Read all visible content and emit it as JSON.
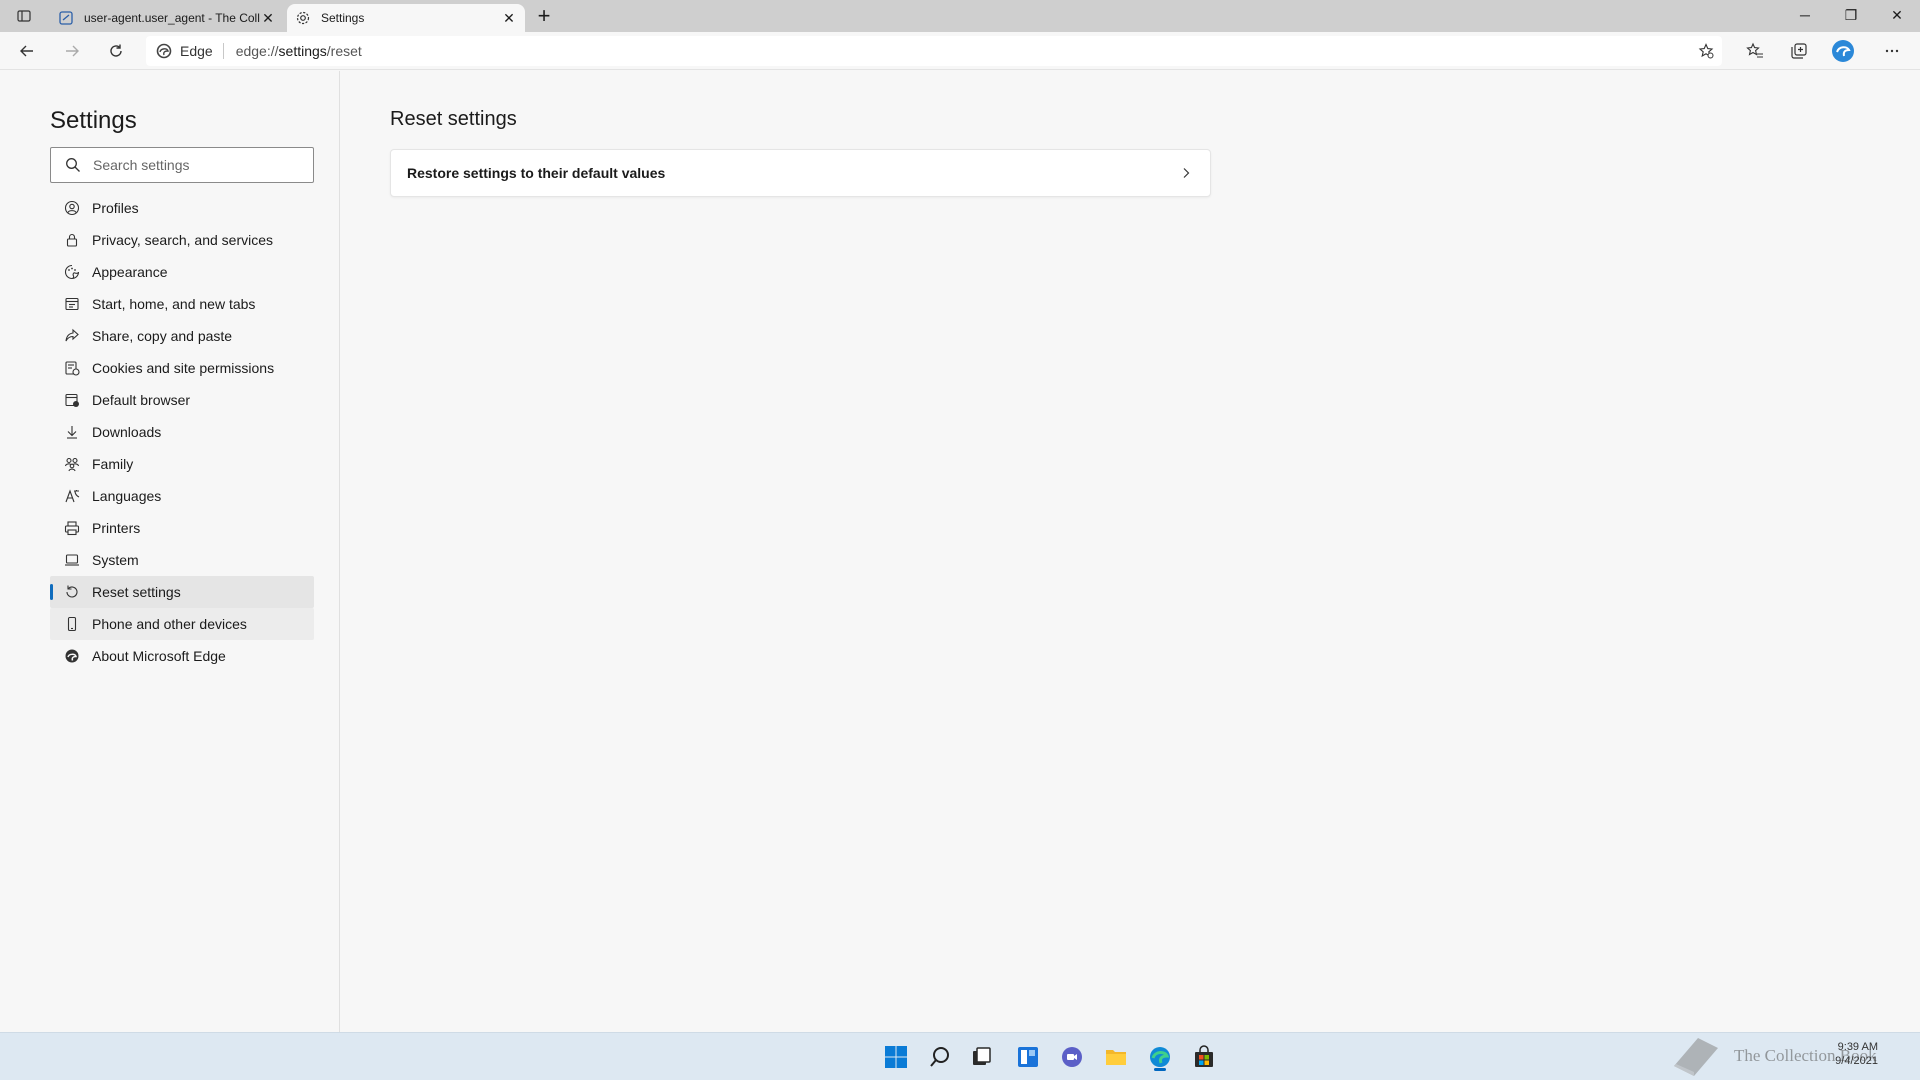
{
  "browser": {
    "tabs": [
      {
        "title": "user-agent.user_agent - The Coll",
        "active": false,
        "icon": "page-icon"
      },
      {
        "title": "Settings",
        "active": true,
        "icon": "gear-icon"
      }
    ],
    "new_tab_label": "+",
    "address": {
      "identity": "Edge",
      "url_prefix": "edge://",
      "url_path": "settings",
      "url_suffix": "/reset"
    }
  },
  "sidebar": {
    "title": "Settings",
    "search_placeholder": "Search settings",
    "items": [
      {
        "label": "Profiles",
        "icon": "profile-icon"
      },
      {
        "label": "Privacy, search, and services",
        "icon": "lock-icon"
      },
      {
        "label": "Appearance",
        "icon": "appearance-icon"
      },
      {
        "label": "Start, home, and new tabs",
        "icon": "home-tabs-icon"
      },
      {
        "label": "Share, copy and paste",
        "icon": "share-icon"
      },
      {
        "label": "Cookies and site permissions",
        "icon": "cookies-icon"
      },
      {
        "label": "Default browser",
        "icon": "default-browser-icon"
      },
      {
        "label": "Downloads",
        "icon": "download-icon"
      },
      {
        "label": "Family",
        "icon": "family-icon"
      },
      {
        "label": "Languages",
        "icon": "languages-icon"
      },
      {
        "label": "Printers",
        "icon": "printer-icon"
      },
      {
        "label": "System",
        "icon": "system-icon"
      },
      {
        "label": "Reset settings",
        "icon": "reset-icon",
        "selected": true
      },
      {
        "label": "Phone and other devices",
        "icon": "phone-icon"
      },
      {
        "label": "About Microsoft Edge",
        "icon": "edge-icon"
      }
    ]
  },
  "main": {
    "title": "Reset settings",
    "card_label": "Restore settings to their default values"
  },
  "taskbar": {
    "clock_time": "9:39 AM",
    "clock_date": "9/4/2021",
    "watermark_text": "The Collection Book"
  },
  "colors": {
    "accent": "#0f6cbd",
    "tabstrip": "#cfcfcf",
    "taskbar": "#dde8f2"
  }
}
